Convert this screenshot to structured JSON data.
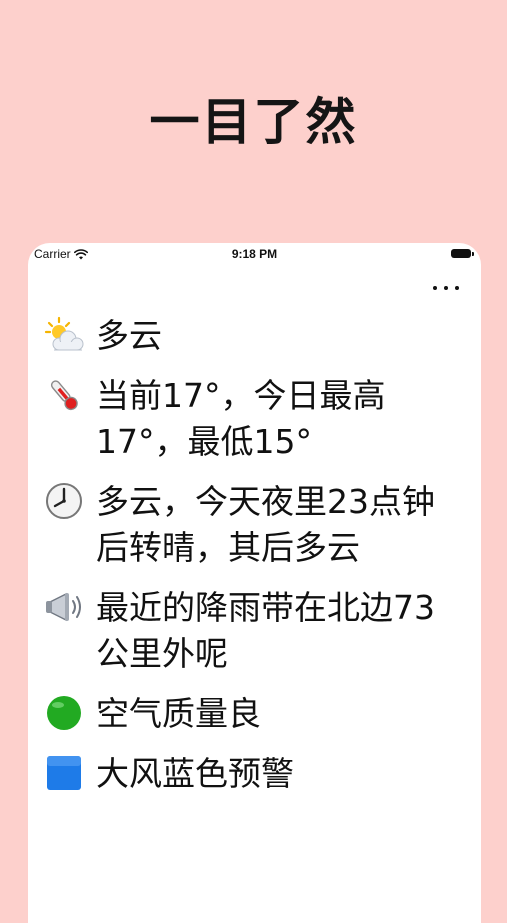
{
  "header": {
    "title": "一目了然"
  },
  "status_bar": {
    "carrier": "Carrier",
    "time": "9:18 PM"
  },
  "weather_items": [
    {
      "icon": "partly-cloudy-icon",
      "text": "多云"
    },
    {
      "icon": "thermometer-icon",
      "text": "当前17°，今日最高17°，最低15°"
    },
    {
      "icon": "clock-icon",
      "text": "多云，今天夜里23点钟后转晴，其后多云"
    },
    {
      "icon": "megaphone-icon",
      "text": "最近的降雨带在北边73公里外呢"
    },
    {
      "icon": "green-circle-icon",
      "text": "空气质量良"
    },
    {
      "icon": "blue-square-icon",
      "text": "大风蓝色预警"
    }
  ],
  "colors": {
    "background": "#fdd0cc",
    "card": "#ffffff",
    "air_quality_good": "#22aa22",
    "wind_warning_blue": "#1e7be8"
  }
}
